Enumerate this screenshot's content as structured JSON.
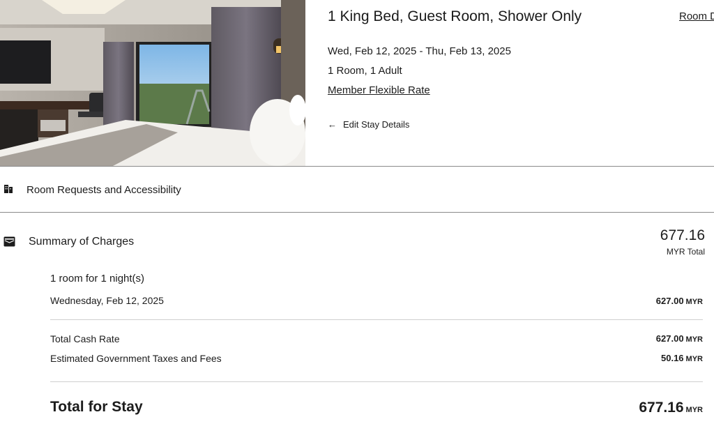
{
  "room": {
    "title": "1 King Bed, Guest Room, Shower Only",
    "details_link": "Room Details",
    "dates": "Wed, Feb 12, 2025 - Thu, Feb 13, 2025",
    "occupancy": "1 Room, 1 Adult",
    "rate_name": "Member Flexible Rate",
    "edit_stay": "Edit Stay Details"
  },
  "requests": {
    "label": "Room Requests and Accessibility",
    "icon": "hotel-icon"
  },
  "summary": {
    "label": "Summary of Charges",
    "icon": "wallet-icon",
    "total": "677.16",
    "total_unit": "MYR Total",
    "nights_label": "1 room for 1 night(s)",
    "nightly": [
      {
        "label": "Wednesday, Feb 12, 2025",
        "amount": "627.00",
        "currency": "MYR"
      }
    ],
    "lines": [
      {
        "label": "Total Cash Rate",
        "amount": "627.00",
        "currency": "MYR"
      },
      {
        "label": "Estimated Government Taxes and Fees",
        "amount": "50.16",
        "currency": "MYR"
      }
    ],
    "grand_label": "Total for Stay",
    "grand_amount": "677.16",
    "grand_currency": "MYR"
  },
  "colors": {
    "text": "#1c1c1c",
    "divider": "#8a8a8a",
    "divider_light": "#cfcfcf"
  }
}
